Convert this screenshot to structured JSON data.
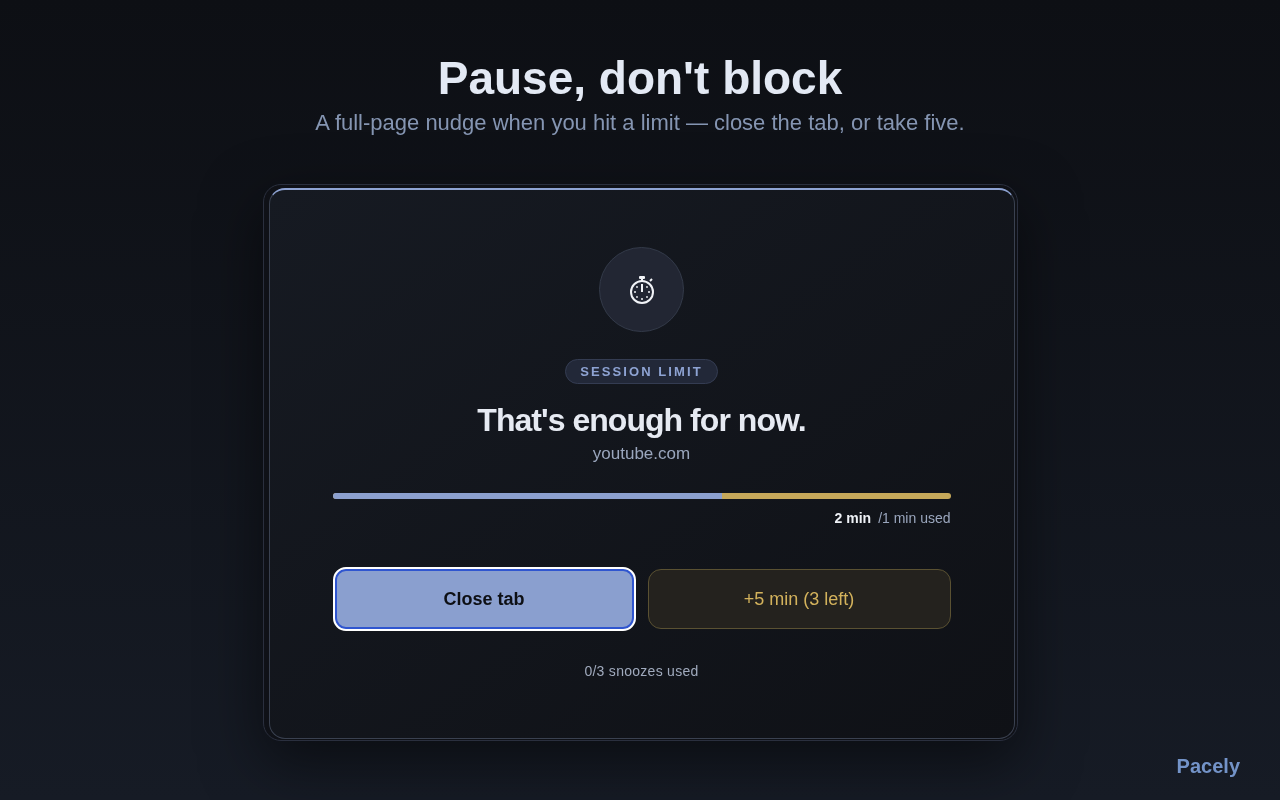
{
  "header": {
    "title": "Pause, don't block",
    "subtitle": "A full-page nudge when you hit a limit — close the tab, or take five."
  },
  "card": {
    "badge": "SESSION LIMIT",
    "title": "That's enough for now.",
    "domain": "youtube.com",
    "usage": {
      "level": 0.63,
      "limit": "2 min",
      "used": "/1 min used"
    },
    "buttons": [
      {
        "kind": "primary",
        "label": "Close tab",
        "focused": true
      },
      {
        "kind": "snooze",
        "label": "+5 min (3 left)",
        "focused": false
      }
    ],
    "snooze_count": "0/3 snoozes used"
  },
  "brand": "Pacely"
}
